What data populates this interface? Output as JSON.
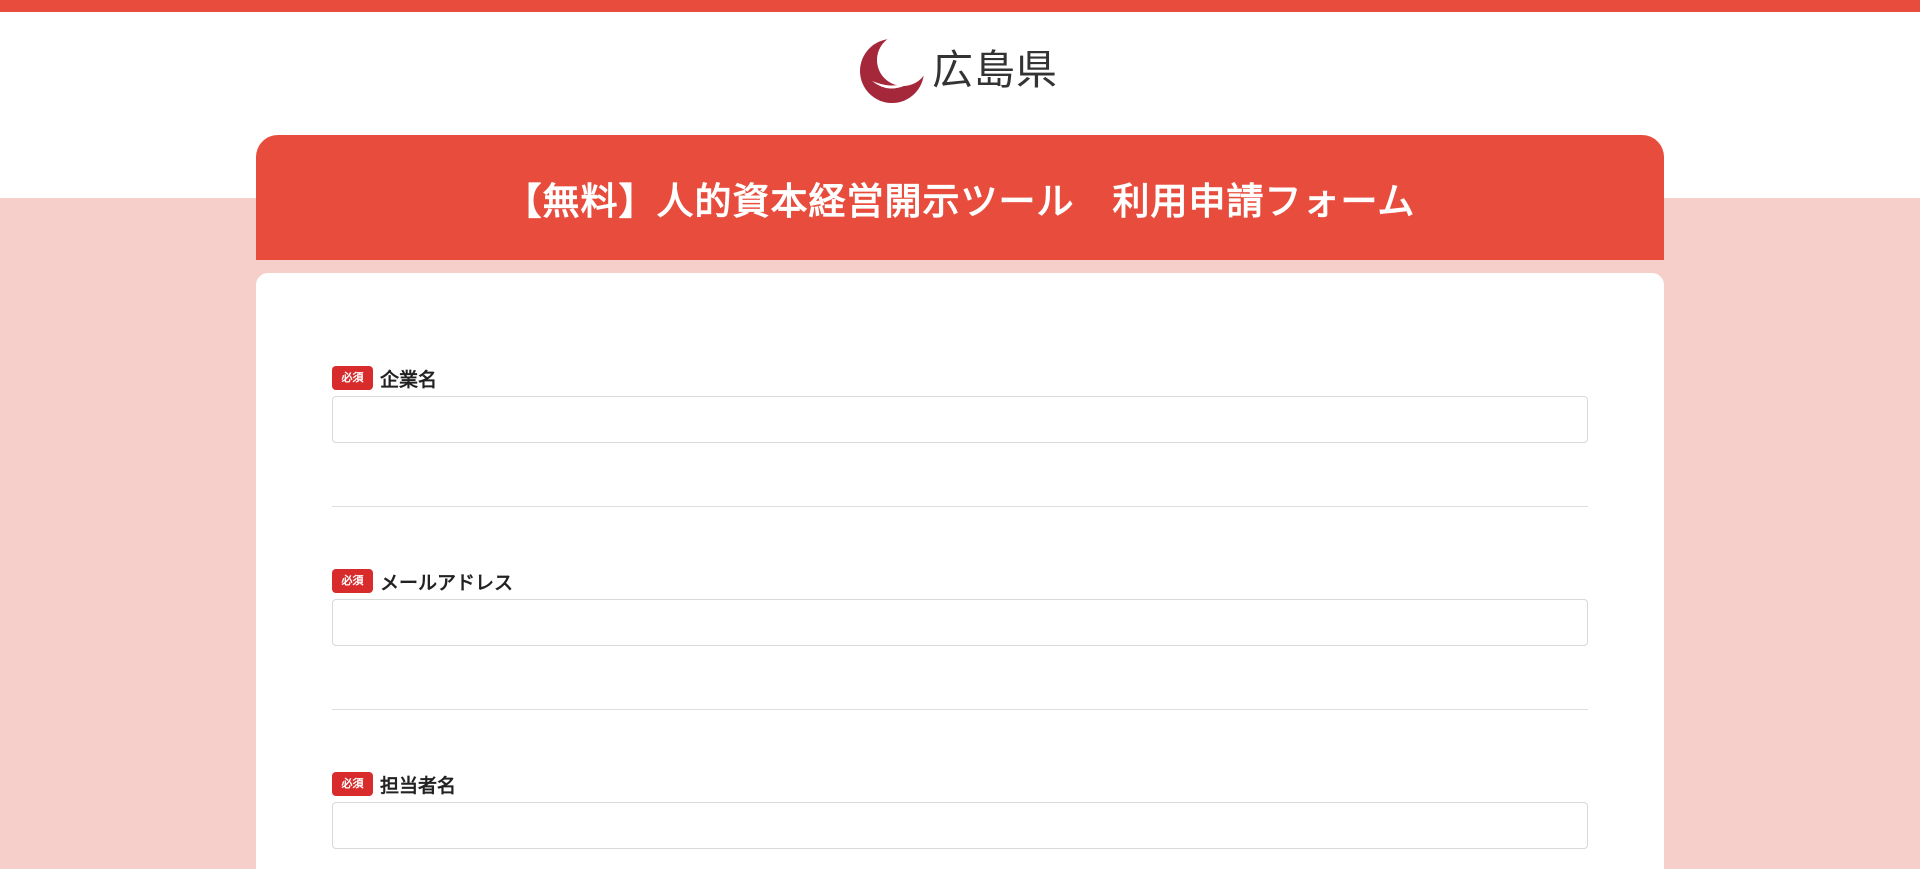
{
  "header": {
    "logo_text": "広島県",
    "logo_icon": "hiroshima-prefecture-crescent-mark",
    "accent_color": "#e84c3d",
    "logo_color": "#a5273a"
  },
  "form": {
    "title": "【無料】人的資本経営開示ツール　利用申請フォーム",
    "fields": [
      {
        "required_label": "必須",
        "label": "企業名",
        "value": "",
        "placeholder": ""
      },
      {
        "required_label": "必須",
        "label": "メールアドレス",
        "value": "",
        "placeholder": ""
      },
      {
        "required_label": "必須",
        "label": "担当者名",
        "value": "",
        "placeholder": ""
      }
    ]
  }
}
